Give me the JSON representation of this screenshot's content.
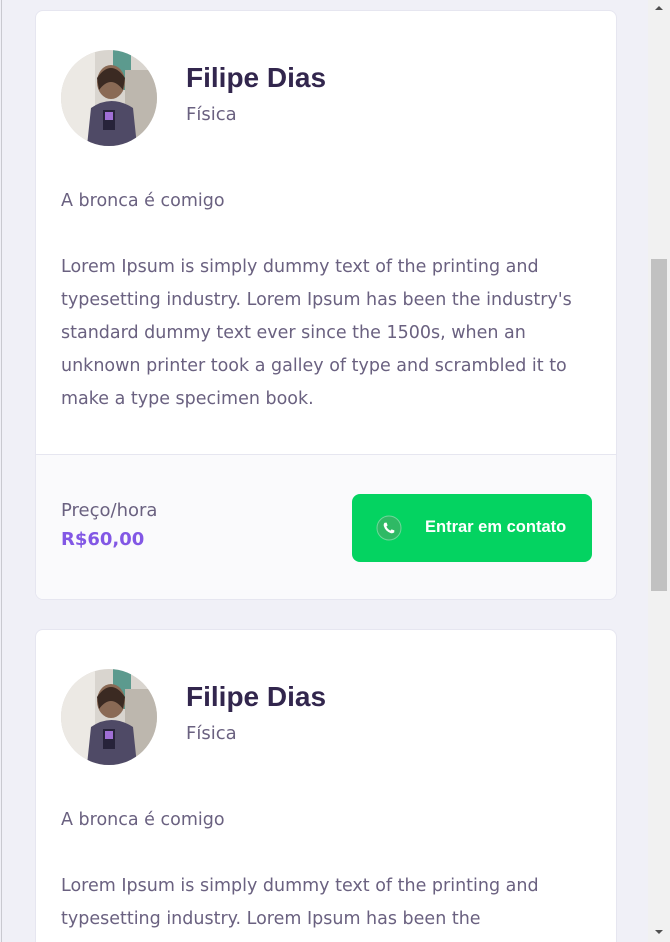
{
  "cards": [
    {
      "name": "Filipe Dias",
      "subject": "Física",
      "bio_intro": "A bronca é comigo",
      "bio_text": "Lorem Ipsum is simply dummy text of the printing and typesetting industry. Lorem Ipsum has been the industry's standard dummy text ever since the 1500s, when an unknown printer took a galley of type and scrambled it to make a type specimen book.",
      "price_label": "Preço/hora",
      "price_value": "R$60,00",
      "contact_label": "Entrar em contato"
    },
    {
      "name": "Filipe Dias",
      "subject": "Física",
      "bio_intro": "A bronca é comigo",
      "bio_text": "Lorem Ipsum is simply dummy text of the printing and typesetting industry. Lorem Ipsum has been the"
    }
  ],
  "colors": {
    "background": "#f0f0f7",
    "title": "#32264d",
    "text": "#6a6180",
    "price": "#8257e5",
    "button": "#04d361"
  },
  "icons": {
    "contact": "whatsapp-icon",
    "scroll_up": "arrow-up-icon",
    "scroll_down": "arrow-down-icon"
  }
}
